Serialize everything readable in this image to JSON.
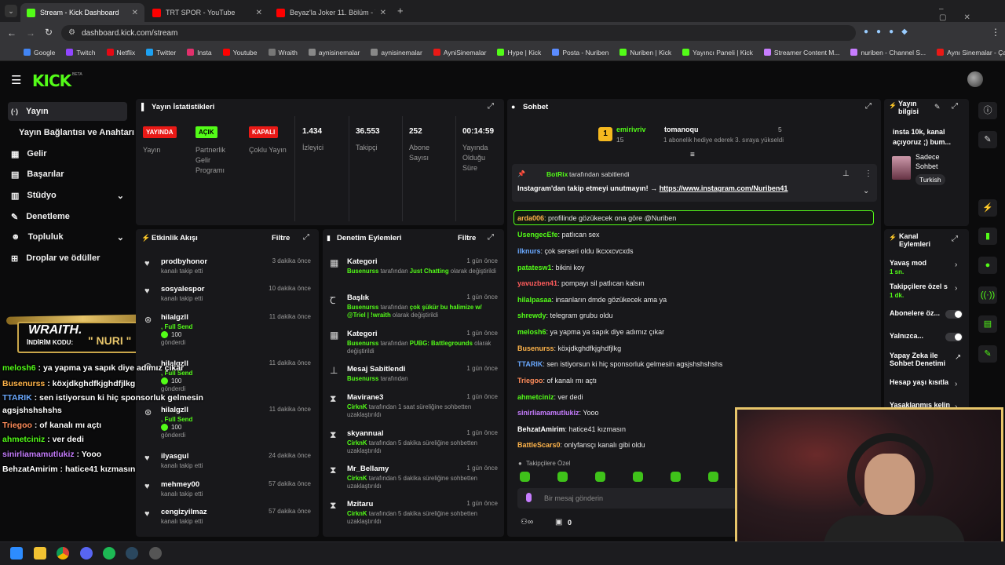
{
  "browser": {
    "tabs": [
      {
        "title": "Stream - Kick Dashboard"
      },
      {
        "title": "TRT SPOR - YouTube"
      },
      {
        "title": "Beyaz'la Joker 11. Bölüm - YouT"
      }
    ],
    "url": "dashboard.kick.com/stream",
    "bookmarks": [
      "Google",
      "Twitch",
      "Netflix",
      "Twitter",
      "Insta",
      "Youtube",
      "Wraith",
      "aynisinemalar",
      "aynisinemalar",
      "AyniSinemalar",
      "Hype | Kick",
      "Posta - Nuriben",
      "Nuriben | Kick",
      "Yayıncı Paneli | Kick",
      "Streamer Content M...",
      "nuriben - Channel S...",
      "Aynı Sinemalar - Ça..."
    ]
  },
  "brand": {
    "logo": "KICK",
    "beta": "BETA"
  },
  "sidebar": {
    "items": [
      {
        "label": "Yayın",
        "icon": "broadcast-icon"
      },
      {
        "label": "Yayın Bağlantısı ve Anahtarı",
        "icon": ""
      },
      {
        "label": "Gelir",
        "icon": "money-icon"
      },
      {
        "label": "Başarılar",
        "icon": "trophy-icon"
      },
      {
        "label": "Stüdyo",
        "icon": "studio-icon"
      },
      {
        "label": "Denetleme",
        "icon": "wrench-icon"
      },
      {
        "label": "Topluluk",
        "icon": "community-icon"
      },
      {
        "label": "Droplar ve ödüller",
        "icon": "gift-icon"
      }
    ]
  },
  "overlay": {
    "brand": "WRAITH.",
    "code_label": "İNDİRİM KODU:",
    "code": "\" NURI \"",
    "chat": [
      {
        "user": "melosh6",
        "text": " : ya yapma ya sapık diye adımız çıkar",
        "color": "#53fc18"
      },
      {
        "user": "Busenurss",
        "text": " : köxjdkghdfkjghdfjlkg",
        "color": "#ffb44a"
      },
      {
        "user": "TTARIK",
        "text": " : sen istiyorsun ki hiç sponsorluk gelmesin",
        "color": "#6aa9ff"
      },
      {
        "user": "",
        "text": "agsjshshshshs",
        "color": "#fff"
      },
      {
        "user": "Triegoo",
        "text": " : of kanalı mı açtı",
        "color": "#ff8c5a"
      },
      {
        "user": "ahmetciniz",
        "text": " : ver dedi",
        "color": "#53fc18"
      },
      {
        "user": "sinirliamamutlukiz",
        "text": " : Yooo",
        "color": "#c77dff"
      },
      {
        "user": "BehzatAmirim",
        "text": " : hatice41 kızmasın",
        "color": "#fff"
      }
    ]
  },
  "stats": {
    "title": "Yayın İstatistikleri",
    "badges": [
      {
        "badge": "YAYINDA",
        "label": "Yayın",
        "color": "#e91916"
      },
      {
        "badge": "AÇIK",
        "label": "Partnerlik Gelir Programı",
        "color": "#53fc18"
      },
      {
        "badge": "KAPALI",
        "label": "Çoklu Yayın",
        "color": "#e91916"
      }
    ],
    "values": [
      {
        "value": "1.434",
        "label": "İzleyici"
      },
      {
        "value": "36.553",
        "label": "Takipçi"
      },
      {
        "value": "252",
        "label": "Abone Sayısı"
      },
      {
        "value": "00:14:59",
        "label": "Yayında Olduğu Süre"
      }
    ]
  },
  "activity": {
    "title": "Etkinlik Akışı",
    "filter": "Filtre",
    "events": [
      {
        "name": "prodbyhonor",
        "sub": "kanalı takip etti",
        "time": "3 dakika önce",
        "icon": "heart-icon"
      },
      {
        "name": "sosyalespor",
        "sub": "kanalı takip etti",
        "time": "10 dakika önce",
        "icon": "heart-icon"
      },
      {
        "name": "hilalgzll",
        "sub": ", Full Send",
        "amount": "100",
        "sub2": "gönderdi",
        "time": "11 dakika önce",
        "icon": "kicks-icon"
      },
      {
        "name": "hilalgzll",
        "sub": ", Full Send",
        "amount": "100",
        "sub2": "gönderdi",
        "time": "11 dakika önce",
        "icon": "kicks-icon"
      },
      {
        "name": "hilalgzll",
        "sub": ", Full Send",
        "amount": "100",
        "sub2": "gönderdi",
        "time": "11 dakika önce",
        "icon": "kicks-icon"
      },
      {
        "name": "ilyasgul",
        "sub": "kanalı takip etti",
        "time": "24 dakika önce",
        "icon": "heart-icon"
      },
      {
        "name": "mehmey00",
        "sub": "kanalı takip etti",
        "time": "57 dakika önce",
        "icon": "heart-icon"
      },
      {
        "name": "cengizyilmaz",
        "sub": "kanalı takip etti",
        "time": "57 dakika önce",
        "icon": "heart-icon"
      }
    ]
  },
  "moderation": {
    "title": "Denetim Eylemleri",
    "filter": "Filtre",
    "actions": [
      {
        "name": "Kategori",
        "actor": "Busenurss",
        "pre": " tarafından ",
        "hl": "Just Chatting",
        "post": " olarak değiştirildi",
        "time": "1 gün önce",
        "icon": "category-icon"
      },
      {
        "name": "Başlık",
        "actor": "Busenurss",
        "pre": " tarafından ",
        "hl": "çok şükür bu halimize w/ @Triel | !wraith",
        "post": " olarak değiştirildi",
        "time": "1 gün önce",
        "icon": "title-icon"
      },
      {
        "name": "Kategori",
        "actor": "Busenurss",
        "pre": " tarafından ",
        "hl": "PUBG: Battlegrounds",
        "post": " olarak değiştirildi",
        "time": "1 gün önce",
        "icon": "category-icon"
      },
      {
        "name": "Mesaj Sabitlendi",
        "actor": "Busenurss",
        "pre": " tarafından",
        "hl": "",
        "post": "",
        "time": "1 gün önce",
        "icon": "pin-icon"
      },
      {
        "name": "Mavirane3",
        "actor": "CirknK",
        "pre": " tarafından 1 saat süreliğine sohbetten uzaklaştırıldı",
        "hl": "",
        "post": "",
        "time": "1 gün önce",
        "icon": "hourglass-icon"
      },
      {
        "name": "skyannual",
        "actor": "CirknK",
        "pre": " tarafından 5 dakika süreliğine sohbetten uzaklaştırıldı",
        "hl": "",
        "post": "",
        "time": "1 gün önce",
        "icon": "hourglass-icon"
      },
      {
        "name": "Mr_Bellamy",
        "actor": "CirknK",
        "pre": " tarafından 5 dakika süreliğine sohbetten uzaklaştırıldı",
        "hl": "",
        "post": "",
        "time": "1 gün önce",
        "icon": "hourglass-icon"
      },
      {
        "name": "Mzitaru",
        "actor": "CirknK",
        "pre": " tarafından 5 dakika süreliğine sohbetten uzaklaştırıldı",
        "hl": "",
        "post": "",
        "time": "1 gün önce",
        "icon": "hourglass-icon"
      }
    ]
  },
  "chat": {
    "title": "Sohbet",
    "gift_user1": "emirivriv",
    "gift_user1_count": "15",
    "gift_user2": "tomanoqu",
    "gift_user2_count": "5",
    "gift_note": "1 abonelik hediye ederek 3. sıraya yükseldi",
    "pinned_by": "BotRix",
    "pinned_suffix": "tarafından sabitlendi",
    "pinned_text": "Instagram'dan takip etmeyi unutmayın! → ",
    "pinned_link": "https://www.instagram.com/Nuriben41",
    "messages": [
      {
        "user": "arda006",
        "text": ": profilinde gözükecek ona göre @Nuriben",
        "color": "#ffb44a",
        "highlight": true
      },
      {
        "user": "UsengecEfe",
        "text": ": patlıcan sex",
        "color": "#53fc18"
      },
      {
        "user": "ilknurs",
        "text": ": çok serseri oldu lkcxxcvcxds",
        "color": "#6aa9ff"
      },
      {
        "user": "patatesw1",
        "text": ": bikini koy",
        "color": "#53fc18"
      },
      {
        "user": "yavuzben41",
        "text": ": pompayı sil patlıcan kalsın",
        "color": "#ff5c5c"
      },
      {
        "user": "hilalpasaa",
        "text": ": insanların dmde gözükecek ama ya",
        "color": "#53fc18"
      },
      {
        "user": "shrewdy",
        "text": ": telegram grubu oldu",
        "color": "#53fc18"
      },
      {
        "user": "melosh6",
        "text": ": ya yapma ya sapık diye adımız çıkar",
        "color": "#53fc18"
      },
      {
        "user": "Busenurss",
        "text": ": köxjdkghdfkjghdfjlkg",
        "color": "#ffb44a"
      },
      {
        "user": "TTARIK",
        "text": ": sen istiyorsun ki hiç sponsorluk gelmesin agsjshshshshs",
        "color": "#6aa9ff"
      },
      {
        "user": "Triegoo",
        "text": ": of kanalı mı açtı",
        "color": "#ff8c5a"
      },
      {
        "user": "ahmetciniz",
        "text": ": ver dedi",
        "color": "#53fc18"
      },
      {
        "user": "sinirliamamutlukiz",
        "text": ": Yooo",
        "color": "#c77dff"
      },
      {
        "user": "BehzatAmirim",
        "text": ": hatice41 kızmasın",
        "color": "#ffffff"
      },
      {
        "user": "BattleScars0",
        "text": ": onlyfansçı kanalı gibi oldu",
        "color": "#ffb44a"
      }
    ],
    "followers_only": "Takipçilere Özel",
    "input_placeholder": "Bir mesaj gönderin",
    "counter": "0"
  },
  "stream_info": {
    "title": "Yayın bilgisi",
    "text": "insta 10k, kanal açıyoruz ;) bum...",
    "category": "Sadece Sohbet",
    "language": "Turkish"
  },
  "channel_actions": {
    "title": "Kanal Eylemleri",
    "items": [
      {
        "label": "Yavaş mod",
        "sub": "1 sn."
      },
      {
        "label": "Takipçilere özel s",
        "sub": "1 dk."
      },
      {
        "label": "Abonelere öz...",
        "sub": ""
      },
      {
        "label": "Yalnızca...",
        "sub": ""
      },
      {
        "label": "Yapay Zeka ile Sohbet Denetimi",
        "sub": ""
      },
      {
        "label": "Hesap yaşı kısıtla",
        "sub": ""
      },
      {
        "label": "Yasaklanmış kelin",
        "sub": ""
      }
    ]
  },
  "colors": {
    "accent": "#53fc18",
    "live": "#e91916",
    "panel": "#18181b"
  }
}
